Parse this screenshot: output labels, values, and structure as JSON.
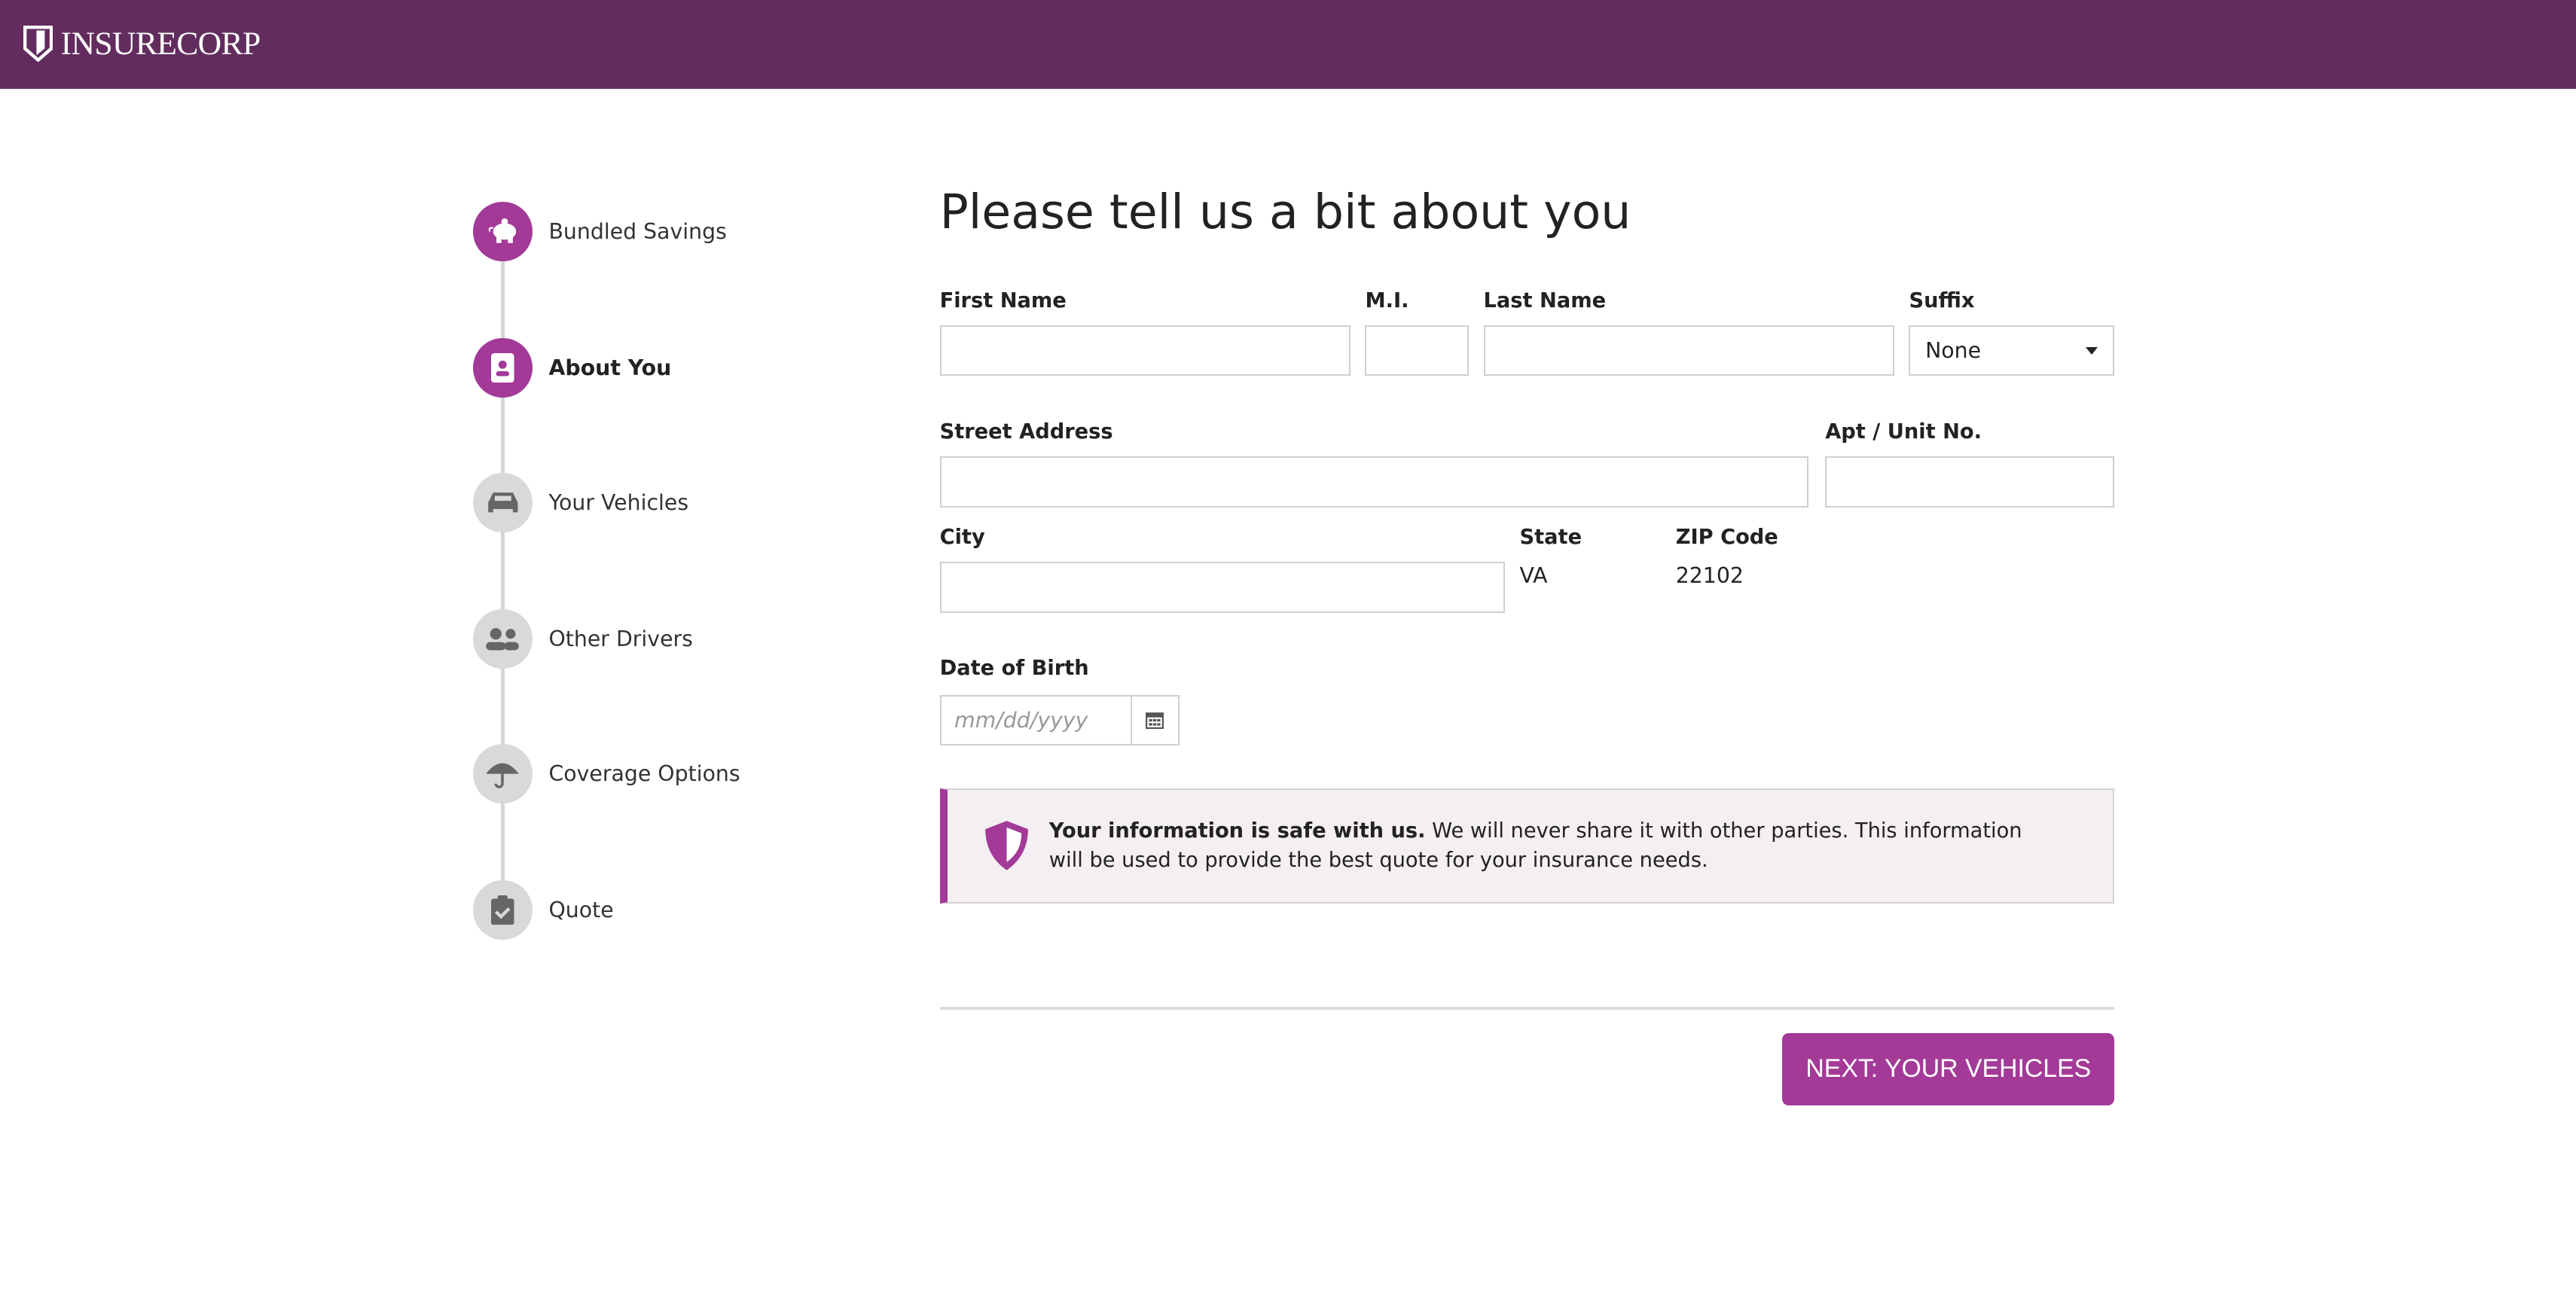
{
  "header": {
    "brand": "INSURECORP",
    "brand_color": "#622d5e"
  },
  "steps": [
    {
      "label": "Bundled Savings",
      "icon": "piggy-bank-icon",
      "state": "completed"
    },
    {
      "label": "About You",
      "icon": "id-badge-icon",
      "state": "current"
    },
    {
      "label": "Your Vehicles",
      "icon": "car-icon",
      "state": "upcoming"
    },
    {
      "label": "Other Drivers",
      "icon": "users-icon",
      "state": "upcoming"
    },
    {
      "label": "Coverage Options",
      "icon": "umbrella-icon",
      "state": "upcoming"
    },
    {
      "label": "Quote",
      "icon": "clipboard-check-icon",
      "state": "upcoming"
    }
  ],
  "form": {
    "title": "Please tell us a bit about you",
    "first_name": {
      "label": "First Name",
      "value": ""
    },
    "mi": {
      "label": "M.I.",
      "value": ""
    },
    "last_name": {
      "label": "Last Name",
      "value": ""
    },
    "suffix": {
      "label": "Suffix",
      "value": "None"
    },
    "street": {
      "label": "Street Address",
      "value": ""
    },
    "apt": {
      "label": "Apt / Unit No.",
      "value": ""
    },
    "city": {
      "label": "City",
      "value": ""
    },
    "state": {
      "label": "State",
      "value": "VA"
    },
    "zip": {
      "label": "ZIP Code",
      "value": "22102"
    },
    "dob": {
      "label": "Date of Birth",
      "placeholder": "mm/dd/yyyy",
      "value": ""
    }
  },
  "info": {
    "bold": "Your information is safe with us.",
    "text": " We will never share it with other parties. This information will be used to provide the best quote for your insurance needs."
  },
  "next_button": "NEXT: YOUR VEHICLES",
  "accent_color": "#a33a98"
}
